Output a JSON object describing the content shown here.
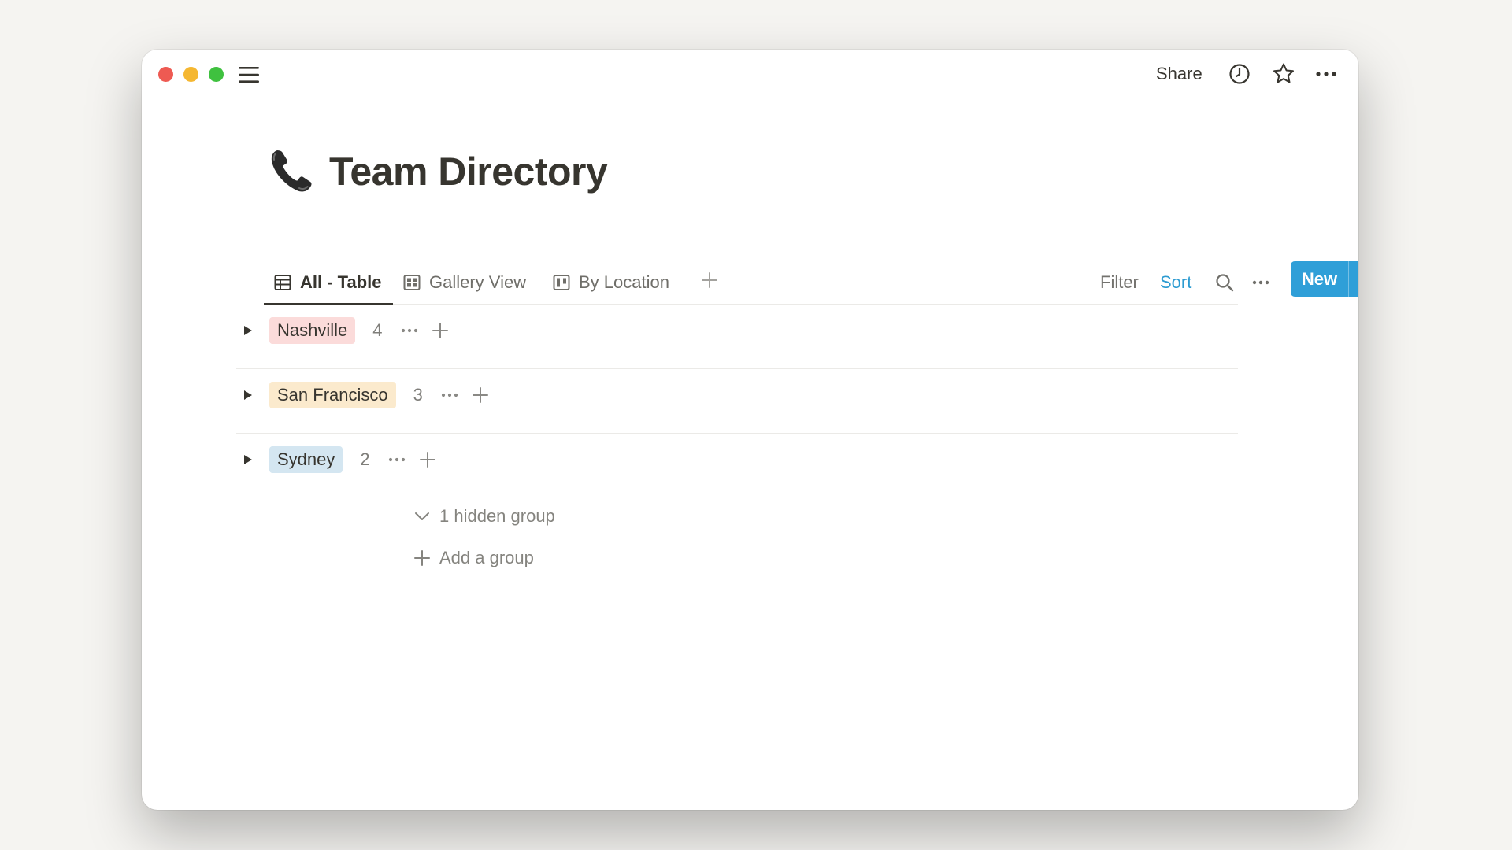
{
  "topbar": {
    "share_label": "Share"
  },
  "page": {
    "emoji": "phone-icon",
    "title": "Team Directory"
  },
  "tabs": [
    {
      "label": "All - Table",
      "icon": "table-icon",
      "active": true
    },
    {
      "label": "Gallery View",
      "icon": "gallery-icon",
      "active": false
    },
    {
      "label": "By Location",
      "icon": "board-icon",
      "active": false
    }
  ],
  "toolbar": {
    "filter_label": "Filter",
    "sort_label": "Sort",
    "new_label": "New"
  },
  "groups": [
    {
      "name": "Nashville",
      "count": "4",
      "color": "#fbdbda"
    },
    {
      "name": "San Francisco",
      "count": "3",
      "color": "#fbeacd"
    },
    {
      "name": "Sydney",
      "count": "2",
      "color": "#d4e6f1"
    }
  ],
  "hidden_group_label": "1 hidden group",
  "add_group_label": "Add a group",
  "colors": {
    "accent": "#2f9fd8",
    "sort_active": "#2d9bd1",
    "text": "#37352f"
  }
}
